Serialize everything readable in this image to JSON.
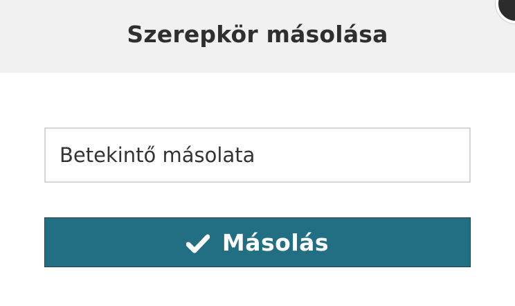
{
  "dialog": {
    "title": "Szerepkör másolása",
    "name_input_value": "Betekintő másolata",
    "copy_button_label": "Másolás",
    "copy_button_icon": "check-icon",
    "close_button_icon": "close-icon"
  },
  "colors": {
    "header_background": "#f1f1f1",
    "primary_button": "#226f84",
    "title_text": "#2f2f2f"
  }
}
